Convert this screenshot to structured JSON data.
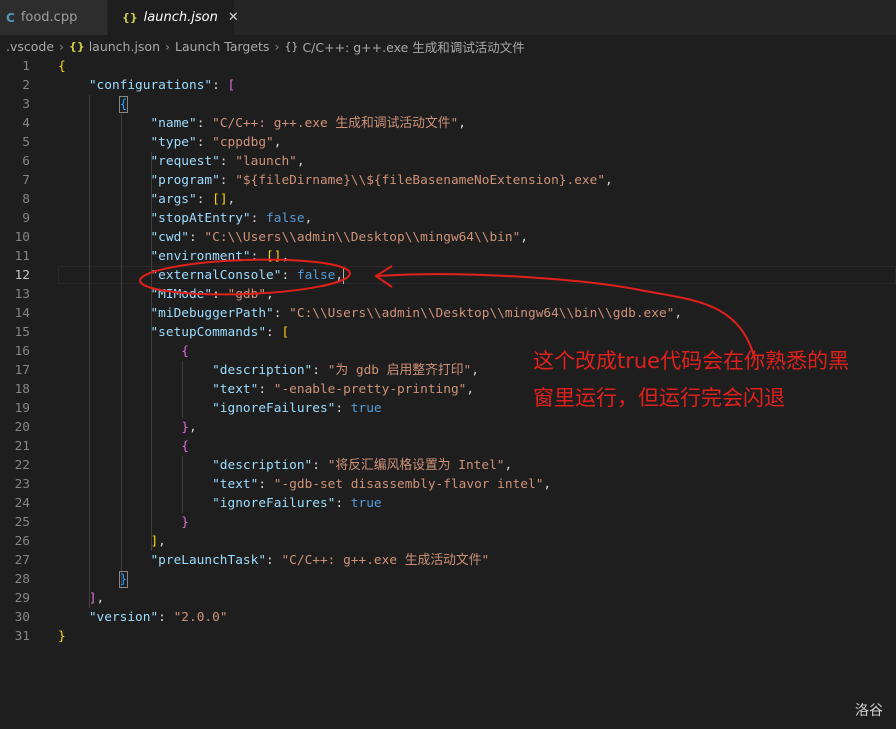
{
  "tabs": [
    {
      "label": "food.cpp",
      "icon": "C",
      "active": false
    },
    {
      "label": "launch.json",
      "icon": "{}",
      "active": true,
      "close": "✕"
    }
  ],
  "breadcrumb": {
    "folder": ".vscode",
    "file": "launch.json",
    "section": "Launch Targets",
    "item": "C/C++: g++.exe 生成和调试活动文件",
    "json_icon": "{}",
    "object_icon": "{}"
  },
  "editor": {
    "current_line": 12,
    "lines": [
      [
        [
          "br1",
          "{"
        ]
      ],
      [
        [
          "p",
          "    "
        ],
        [
          "k",
          "\"configurations\""
        ],
        [
          "p",
          ": "
        ],
        [
          "br2",
          "["
        ]
      ],
      [
        [
          "p",
          "        "
        ],
        [
          "br3",
          "{"
        ]
      ],
      [
        [
          "p",
          "            "
        ],
        [
          "k",
          "\"name\""
        ],
        [
          "p",
          ": "
        ],
        [
          "s",
          "\"C/C++: g++.exe 生成和调试活动文件\""
        ],
        [
          "p",
          ","
        ]
      ],
      [
        [
          "p",
          "            "
        ],
        [
          "k",
          "\"type\""
        ],
        [
          "p",
          ": "
        ],
        [
          "s",
          "\"cppdbg\""
        ],
        [
          "p",
          ","
        ]
      ],
      [
        [
          "p",
          "            "
        ],
        [
          "k",
          "\"request\""
        ],
        [
          "p",
          ": "
        ],
        [
          "s",
          "\"launch\""
        ],
        [
          "p",
          ","
        ]
      ],
      [
        [
          "p",
          "            "
        ],
        [
          "k",
          "\"program\""
        ],
        [
          "p",
          ": "
        ],
        [
          "s",
          "\"${fileDirname}\\\\${fileBasenameNoExtension}.exe\""
        ],
        [
          "p",
          ","
        ]
      ],
      [
        [
          "p",
          "            "
        ],
        [
          "k",
          "\"args\""
        ],
        [
          "p",
          ": "
        ],
        [
          "br1",
          "[]"
        ],
        [
          "p",
          ","
        ]
      ],
      [
        [
          "p",
          "            "
        ],
        [
          "k",
          "\"stopAtEntry\""
        ],
        [
          "p",
          ": "
        ],
        [
          "b",
          "false"
        ],
        [
          "p",
          ","
        ]
      ],
      [
        [
          "p",
          "            "
        ],
        [
          "k",
          "\"cwd\""
        ],
        [
          "p",
          ": "
        ],
        [
          "s",
          "\"C:\\\\Users\\\\admin\\\\Desktop\\\\mingw64\\\\bin\""
        ],
        [
          "p",
          ","
        ]
      ],
      [
        [
          "p",
          "            "
        ],
        [
          "k",
          "\"environment\""
        ],
        [
          "p",
          ": "
        ],
        [
          "br1",
          "[]"
        ],
        [
          "p",
          ","
        ]
      ],
      [
        [
          "p",
          "            "
        ],
        [
          "k",
          "\"externalConsole\""
        ],
        [
          "p",
          ": "
        ],
        [
          "b",
          "false"
        ],
        [
          "p",
          ","
        ]
      ],
      [
        [
          "p",
          "            "
        ],
        [
          "k",
          "\"MIMode\""
        ],
        [
          "p",
          ": "
        ],
        [
          "s",
          "\"gdb\""
        ],
        [
          "p",
          ","
        ]
      ],
      [
        [
          "p",
          "            "
        ],
        [
          "k",
          "\"miDebuggerPath\""
        ],
        [
          "p",
          ": "
        ],
        [
          "s",
          "\"C:\\\\Users\\\\admin\\\\Desktop\\\\mingw64\\\\bin\\\\gdb.exe\""
        ],
        [
          "p",
          ","
        ]
      ],
      [
        [
          "p",
          "            "
        ],
        [
          "k",
          "\"setupCommands\""
        ],
        [
          "p",
          ": "
        ],
        [
          "br1",
          "["
        ]
      ],
      [
        [
          "p",
          "                "
        ],
        [
          "br2",
          "{"
        ]
      ],
      [
        [
          "p",
          "                    "
        ],
        [
          "k",
          "\"description\""
        ],
        [
          "p",
          ": "
        ],
        [
          "s",
          "\"为 gdb 启用整齐打印\""
        ],
        [
          "p",
          ","
        ]
      ],
      [
        [
          "p",
          "                    "
        ],
        [
          "k",
          "\"text\""
        ],
        [
          "p",
          ": "
        ],
        [
          "s",
          "\"-enable-pretty-printing\""
        ],
        [
          "p",
          ","
        ]
      ],
      [
        [
          "p",
          "                    "
        ],
        [
          "k",
          "\"ignoreFailures\""
        ],
        [
          "p",
          ": "
        ],
        [
          "b",
          "true"
        ]
      ],
      [
        [
          "p",
          "                "
        ],
        [
          "br2",
          "}"
        ],
        [
          "p",
          ","
        ]
      ],
      [
        [
          "p",
          "                "
        ],
        [
          "br2",
          "{"
        ]
      ],
      [
        [
          "p",
          "                    "
        ],
        [
          "k",
          "\"description\""
        ],
        [
          "p",
          ": "
        ],
        [
          "s",
          "\"将反汇编风格设置为 Intel\""
        ],
        [
          "p",
          ","
        ]
      ],
      [
        [
          "p",
          "                    "
        ],
        [
          "k",
          "\"text\""
        ],
        [
          "p",
          ": "
        ],
        [
          "s",
          "\"-gdb-set disassembly-flavor intel\""
        ],
        [
          "p",
          ","
        ]
      ],
      [
        [
          "p",
          "                    "
        ],
        [
          "k",
          "\"ignoreFailures\""
        ],
        [
          "p",
          ": "
        ],
        [
          "b",
          "true"
        ]
      ],
      [
        [
          "p",
          "                "
        ],
        [
          "br2",
          "}"
        ]
      ],
      [
        [
          "p",
          "            "
        ],
        [
          "br1",
          "]"
        ],
        [
          "p",
          ","
        ]
      ],
      [
        [
          "p",
          "            "
        ],
        [
          "k",
          "\"preLaunchTask\""
        ],
        [
          "p",
          ": "
        ],
        [
          "s",
          "\"C/C++: g++.exe 生成活动文件\""
        ]
      ],
      [
        [
          "p",
          "        "
        ],
        [
          "br3",
          "}"
        ]
      ],
      [
        [
          "p",
          "    "
        ],
        [
          "br2",
          "]"
        ],
        [
          "p",
          ","
        ]
      ],
      [
        [
          "p",
          "    "
        ],
        [
          "k",
          "\"version\""
        ],
        [
          "p",
          ": "
        ],
        [
          "s",
          "\"2.0.0\""
        ]
      ],
      [
        [
          "br1",
          "}"
        ]
      ]
    ]
  },
  "annotation": {
    "text": "这个改成true代码会在你熟悉的黑窗里运行，但运行完会闪退",
    "color": "#e0201b"
  },
  "watermark": "洛谷",
  "colors": {
    "background": "#1e1e1e",
    "key": "#9cdcfe",
    "string": "#ce9178",
    "boolean": "#569cd6",
    "bracket_gold": "#ffd700",
    "bracket_purple": "#da70d6",
    "bracket_blue": "#179fff"
  }
}
